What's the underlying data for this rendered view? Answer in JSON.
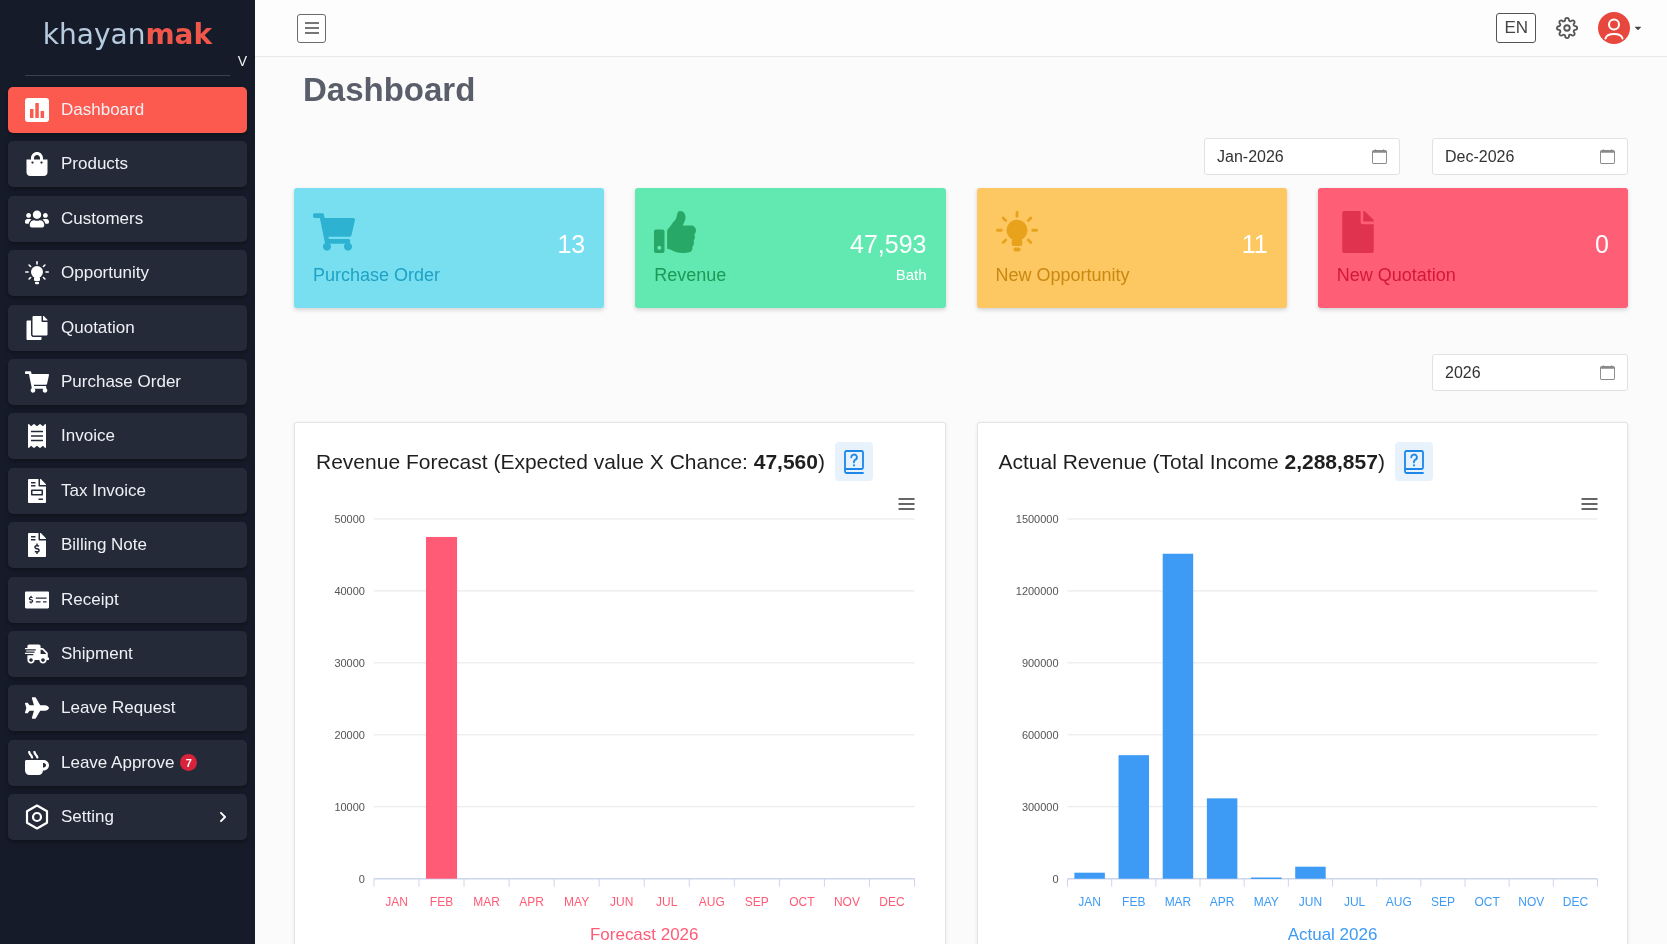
{
  "sidebar": {
    "brand": {
      "name_start": "khayan",
      "name_end": "mak"
    },
    "caption": "V",
    "items": [
      {
        "label": "Dashboard",
        "selected": true,
        "kind": "link"
      },
      {
        "label": "Products",
        "selected": false,
        "kind": "link"
      },
      {
        "label": "Customers",
        "selected": false,
        "kind": "link"
      },
      {
        "label": "Opportunity",
        "selected": false,
        "kind": "link"
      },
      {
        "label": "Quotation",
        "selected": false,
        "kind": "link"
      },
      {
        "label": "Purchase Order",
        "selected": false,
        "kind": "link"
      },
      {
        "label": "Invoice",
        "selected": false,
        "kind": "link"
      },
      {
        "label": "Tax Invoice",
        "selected": false,
        "kind": "link"
      },
      {
        "label": "Billing Note",
        "selected": false,
        "kind": "link"
      },
      {
        "label": "Receipt",
        "selected": false,
        "kind": "link"
      },
      {
        "label": "Shipment",
        "selected": false,
        "kind": "link"
      },
      {
        "label": "Leave Request",
        "selected": false,
        "kind": "link"
      },
      {
        "label": "Leave Approve",
        "selected": false,
        "kind": "link",
        "badge": "7"
      },
      {
        "label": "Setting",
        "selected": false,
        "kind": "group"
      }
    ]
  },
  "header": {
    "language": "EN"
  },
  "page_title": "Dashboard",
  "date_range": {
    "from": "Jan-2026",
    "to": "Dec-2026"
  },
  "stat_cards": [
    {
      "kind": "purchase_order",
      "label": "Purchase Order",
      "value": "13",
      "color": "#78dff1"
    },
    {
      "kind": "revenue",
      "label": "Revenue",
      "value": "47,593",
      "unit": "Bath",
      "color": "#62e8b1"
    },
    {
      "kind": "opportunity",
      "label": "New Opportunity",
      "value": "11",
      "color": "#fdc762"
    },
    {
      "kind": "quotation",
      "label": "New Quotation",
      "value": "0",
      "color": "#ff5e77"
    }
  ],
  "year": "2026",
  "charts": [
    {
      "title": "Revenue Forecast (Expected value X Chance: **47,560**)",
      "chart_data": {
        "type": "bar",
        "xlabel": "Forecast 2026",
        "categories": [
          "JAN",
          "FEB",
          "MAR",
          "APR",
          "MAY",
          "JUN",
          "JUL",
          "AUG",
          "SEP",
          "OCT",
          "NOV",
          "DEC"
        ],
        "series": [
          {
            "color": "#ff5b77",
            "values": [
              0,
              47500,
              0,
              0,
              0,
              0,
              0,
              0,
              0,
              0,
              0,
              0
            ]
          }
        ],
        "ylim": [
          0,
          50000
        ],
        "yticks": [
          0,
          10000,
          20000,
          30000,
          40000,
          50000
        ],
        "grid": true
      }
    },
    {
      "title": "Actual Revenue (Total Income **2,288,857**)",
      "chart_data": {
        "type": "bar",
        "xlabel": "Actual 2026",
        "categories": [
          "JAN",
          "FEB",
          "MAR",
          "APR",
          "MAY",
          "JUN",
          "JUL",
          "AUG",
          "SEP",
          "OCT",
          "NOV",
          "DEC"
        ],
        "series": [
          {
            "color": "#3d9bf5",
            "values": [
              25000,
              515000,
              1355000,
              335000,
              5000,
              50000,
              0,
              0,
              0,
              0,
              0,
              0
            ]
          }
        ],
        "ylim": [
          0,
          1500000
        ],
        "yticks": [
          0,
          300000,
          600000,
          900000,
          1200000,
          1500000
        ],
        "grid": true
      }
    }
  ]
}
